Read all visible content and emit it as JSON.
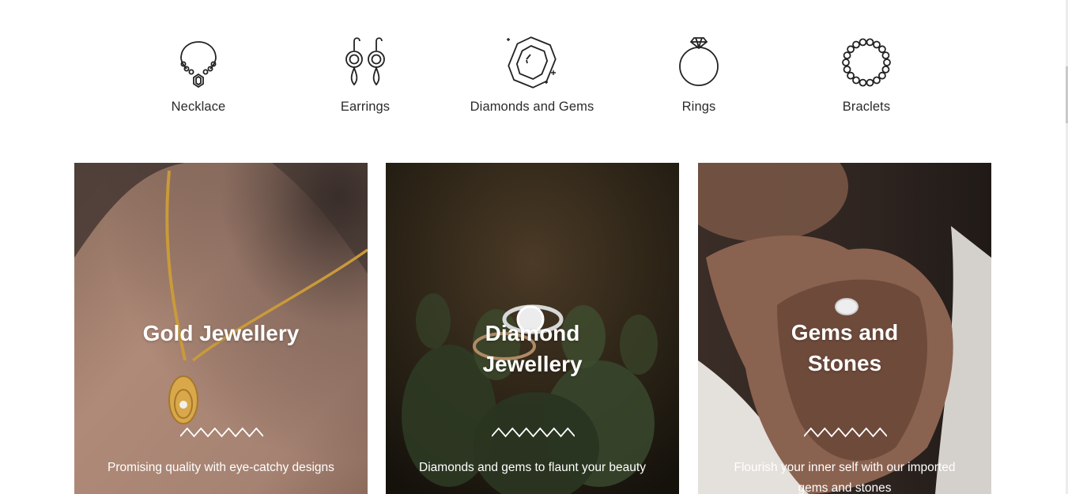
{
  "categories": [
    {
      "label": "Necklace",
      "icon": "necklace-icon"
    },
    {
      "label": "Earrings",
      "icon": "earrings-icon"
    },
    {
      "label": "Diamonds and Gems",
      "icon": "diamond-gem-icon"
    },
    {
      "label": "Rings",
      "icon": "ring-icon"
    },
    {
      "label": "Braclets",
      "icon": "bracelet-icon"
    }
  ],
  "cards": [
    {
      "title": "Gold Jewellery",
      "description": "Promising quality with eye-catchy designs",
      "image": "gold-necklace-photo"
    },
    {
      "title": "Diamond Jewellery",
      "description": "Diamonds and gems to flaunt your beauty",
      "image": "diamond-ring-photo"
    },
    {
      "title": "Gems and Stones",
      "description": "Flourish your inner self with our imported gems and stones",
      "image": "gem-ring-hands-photo"
    }
  ],
  "colors": {
    "text": "#2b2b2b",
    "background": "#ffffff",
    "overlay_text": "#ffffff"
  }
}
